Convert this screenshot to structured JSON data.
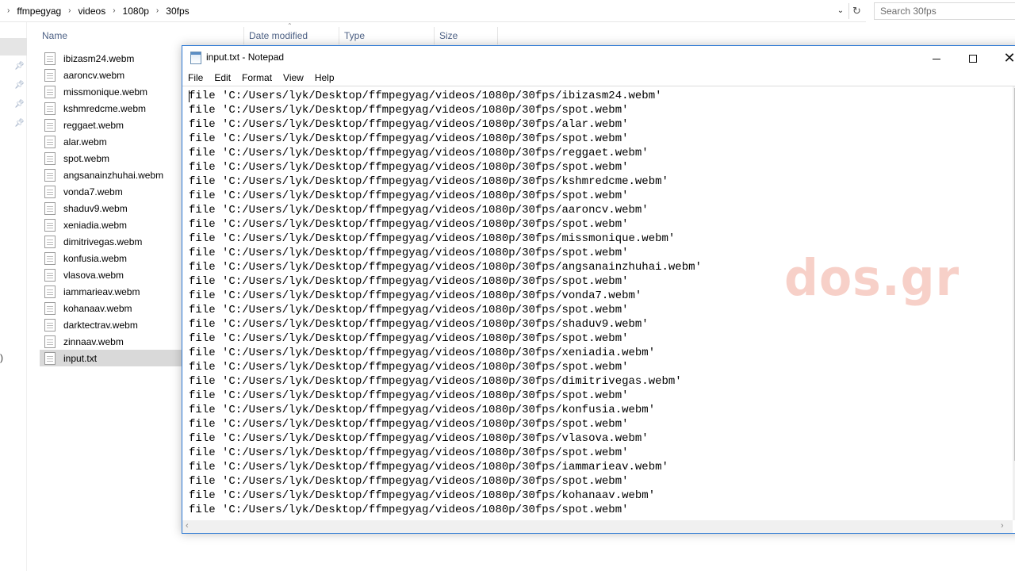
{
  "explorer": {
    "breadcrumb": [
      "ffmpegyag",
      "videos",
      "1080p",
      "30fps"
    ],
    "search_placeholder": "Search 30fps",
    "columns": [
      "Name",
      "Date modified",
      "Type",
      "Size"
    ],
    "nav_paren": ")",
    "files": [
      "ibizasm24.webm",
      "aaroncv.webm",
      "missmonique.webm",
      "kshmredcme.webm",
      "reggaet.webm",
      "alar.webm",
      "spot.webm",
      "angsanainzhuhai.webm",
      "vonda7.webm",
      "shaduv9.webm",
      "xeniadia.webm",
      "dimitrivegas.webm",
      "konfusia.webm",
      "vlasova.webm",
      "iammarieav.webm",
      "kohanaav.webm",
      "darktectrav.webm",
      "zinnaav.webm",
      "input.txt"
    ],
    "selected_file": "input.txt"
  },
  "notepad": {
    "title": "input.txt - Notepad",
    "menu": [
      "File",
      "Edit",
      "Format",
      "View",
      "Help"
    ],
    "lines": [
      "file 'C:/Users/lyk/Desktop/ffmpegyag/videos/1080p/30fps/ibizasm24.webm'",
      "file 'C:/Users/lyk/Desktop/ffmpegyag/videos/1080p/30fps/spot.webm'",
      "file 'C:/Users/lyk/Desktop/ffmpegyag/videos/1080p/30fps/alar.webm'",
      "file 'C:/Users/lyk/Desktop/ffmpegyag/videos/1080p/30fps/spot.webm'",
      "file 'C:/Users/lyk/Desktop/ffmpegyag/videos/1080p/30fps/reggaet.webm'",
      "file 'C:/Users/lyk/Desktop/ffmpegyag/videos/1080p/30fps/spot.webm'",
      "file 'C:/Users/lyk/Desktop/ffmpegyag/videos/1080p/30fps/kshmredcme.webm'",
      "file 'C:/Users/lyk/Desktop/ffmpegyag/videos/1080p/30fps/spot.webm'",
      "file 'C:/Users/lyk/Desktop/ffmpegyag/videos/1080p/30fps/aaroncv.webm'",
      "file 'C:/Users/lyk/Desktop/ffmpegyag/videos/1080p/30fps/spot.webm'",
      "file 'C:/Users/lyk/Desktop/ffmpegyag/videos/1080p/30fps/missmonique.webm'",
      "file 'C:/Users/lyk/Desktop/ffmpegyag/videos/1080p/30fps/spot.webm'",
      "file 'C:/Users/lyk/Desktop/ffmpegyag/videos/1080p/30fps/angsanainzhuhai.webm'",
      "file 'C:/Users/lyk/Desktop/ffmpegyag/videos/1080p/30fps/spot.webm'",
      "file 'C:/Users/lyk/Desktop/ffmpegyag/videos/1080p/30fps/vonda7.webm'",
      "file 'C:/Users/lyk/Desktop/ffmpegyag/videos/1080p/30fps/spot.webm'",
      "file 'C:/Users/lyk/Desktop/ffmpegyag/videos/1080p/30fps/shaduv9.webm'",
      "file 'C:/Users/lyk/Desktop/ffmpegyag/videos/1080p/30fps/spot.webm'",
      "file 'C:/Users/lyk/Desktop/ffmpegyag/videos/1080p/30fps/xeniadia.webm'",
      "file 'C:/Users/lyk/Desktop/ffmpegyag/videos/1080p/30fps/spot.webm'",
      "file 'C:/Users/lyk/Desktop/ffmpegyag/videos/1080p/30fps/dimitrivegas.webm'",
      "file 'C:/Users/lyk/Desktop/ffmpegyag/videos/1080p/30fps/spot.webm'",
      "file 'C:/Users/lyk/Desktop/ffmpegyag/videos/1080p/30fps/konfusia.webm'",
      "file 'C:/Users/lyk/Desktop/ffmpegyag/videos/1080p/30fps/spot.webm'",
      "file 'C:/Users/lyk/Desktop/ffmpegyag/videos/1080p/30fps/vlasova.webm'",
      "file 'C:/Users/lyk/Desktop/ffmpegyag/videos/1080p/30fps/spot.webm'",
      "file 'C:/Users/lyk/Desktop/ffmpegyag/videos/1080p/30fps/iammarieav.webm'",
      "file 'C:/Users/lyk/Desktop/ffmpegyag/videos/1080p/30fps/spot.webm'",
      "file 'C:/Users/lyk/Desktop/ffmpegyag/videos/1080p/30fps/kohanaav.webm'",
      "file 'C:/Users/lyk/Desktop/ffmpegyag/videos/1080p/30fps/spot.webm'"
    ]
  },
  "watermark": "dos.gr",
  "colors": {
    "accent_border": "#2b78d4",
    "column_header": "#4d6185",
    "selection": "#d9d9d9",
    "watermark": "#f6c8bf"
  },
  "icons": {
    "crumb_separator": "chevron-right-icon",
    "address_dropdown": "chevron-down-icon",
    "refresh": "refresh-icon",
    "pin": "pin-icon",
    "file": "file-icon",
    "minimize": "minimize-icon",
    "maximize": "maximize-icon",
    "close": "close-icon"
  }
}
